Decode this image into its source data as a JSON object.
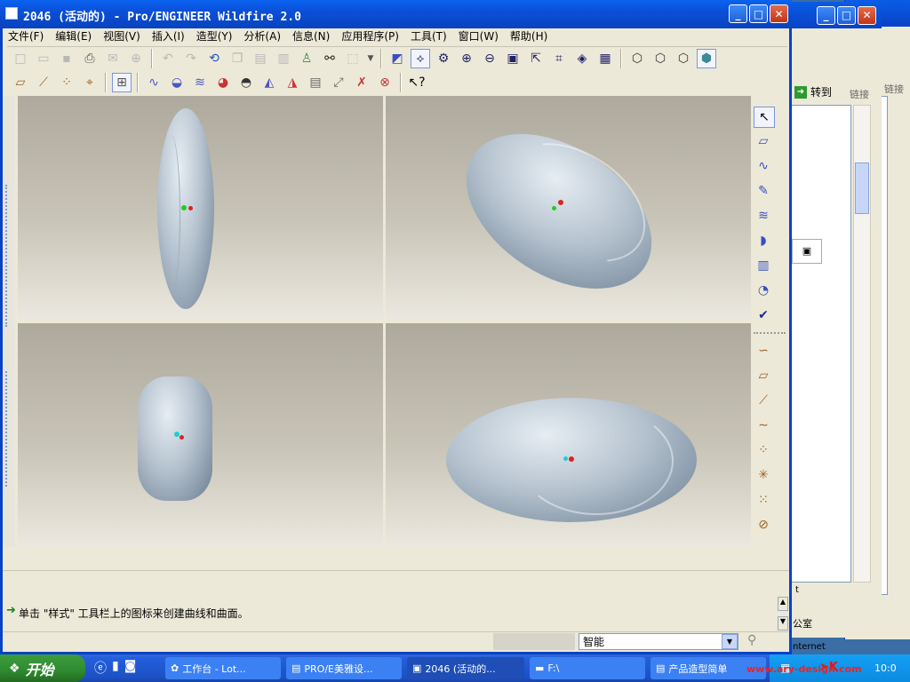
{
  "window": {
    "title": "2046 (活动的) - Pro/ENGINEER Wildfire 2.0"
  },
  "menu": [
    "文件(F)",
    "编辑(E)",
    "视图(V)",
    "插入(I)",
    "造型(Y)",
    "分析(A)",
    "信息(N)",
    "应用程序(P)",
    "工具(T)",
    "窗口(W)",
    "帮助(H)"
  ],
  "status": {
    "message": "单击 \"样式\" 工具栏上的图标来创建曲线和曲面。",
    "filter_value": "智能"
  },
  "background_window": {
    "goto_label": "转到",
    "links_label": "链接",
    "links_label2": "链接",
    "office_label": "公室",
    "internet_label": "nternet",
    "status_letter": "t"
  },
  "taskbar": {
    "start_label": "开始",
    "tasks": [
      "工作台 - Lot...",
      "PRO/E美雅设...",
      "2046 (活动的...",
      "F:\\",
      "产品造型简单"
    ],
    "clock": "10:0",
    "watermark": "www.ary-design.com"
  },
  "colors": {
    "title_blue": "#0a63f0",
    "viewport_top": "#aea99d",
    "viewport_bottom": "#ebe8df",
    "shape": "#b6c3cf"
  },
  "icons": {
    "toolbar1": [
      "new-icon",
      "open-icon",
      "save-icon",
      "print-icon",
      "email-icon",
      "email-link-icon",
      "undo-icon",
      "redo-icon",
      "regenerate-icon",
      "copy-icon",
      "paste-icon",
      "paste-special-icon",
      "model-tree-icon",
      "find-icon",
      "select-box-icon",
      "dropdown-icon",
      "datum-planes-icon",
      "datum-axes-icon",
      "datum-points-icon",
      "zoom-in-icon",
      "zoom-out-icon",
      "refit-icon",
      "orient-icon",
      "named-views-icon",
      "layers-icon",
      "view-manager-icon",
      "wireframe-icon",
      "hidden-line-icon",
      "no-hidden-icon",
      "shading-icon"
    ],
    "toolbar2": [
      "plane-icon",
      "axis-icon",
      "point-icon",
      "csys-icon",
      "four-view-icon",
      "curve-icon",
      "surface-icon",
      "curve-edit-icon",
      "shade-analysis-icon",
      "reflect-analysis-icon",
      "draft-icon",
      "curvature-icon",
      "section-icon",
      "snap-icon",
      "delete-analysis-icon",
      "delete-all-icon",
      "help-icon"
    ],
    "right_tools": [
      "select-icon",
      "active-plane-icon",
      "curve-create-icon",
      "curve-edit-icon",
      "surface-icon",
      "surface-connect-icon",
      "surface-trim-icon",
      "surface-edit-icon",
      "done-icon",
      "drop-curve-icon",
      "plane-curve-icon",
      "line-icon",
      "free-curve-icon",
      "point-icon",
      "intersect-icon",
      "offset-icon",
      "link-icon"
    ]
  }
}
